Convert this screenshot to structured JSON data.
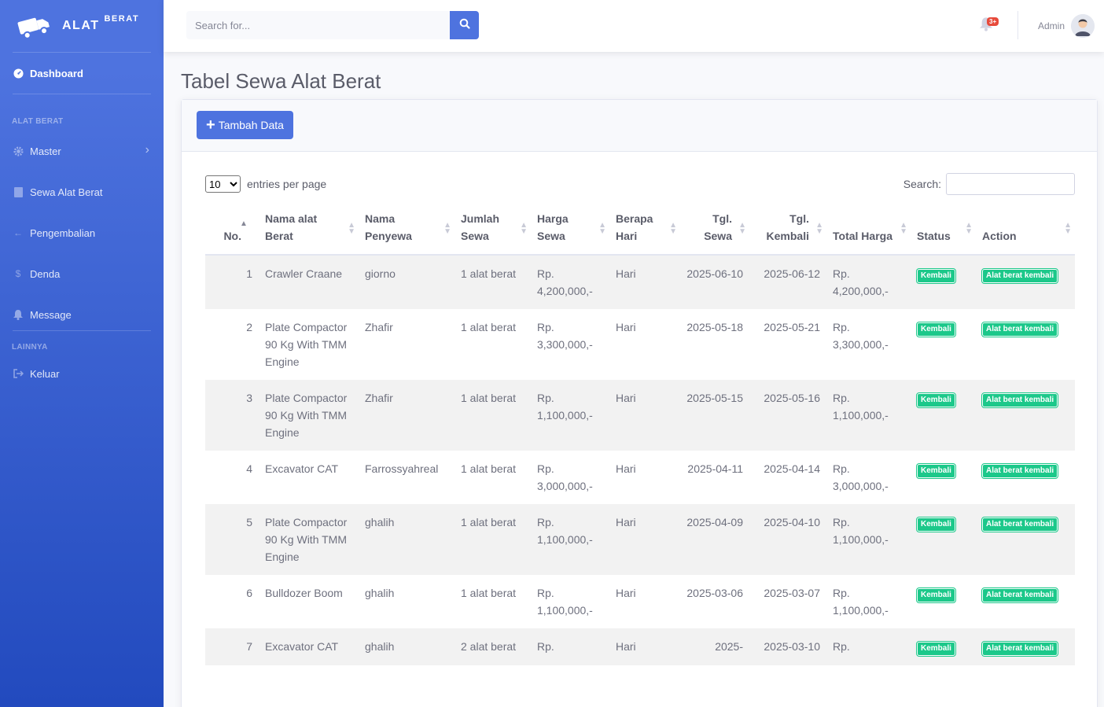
{
  "brand": {
    "name": "ALAT",
    "sup": "BERAT"
  },
  "sidebar": {
    "dashboard": "Dashboard",
    "heading1": "ALAT BERAT",
    "items1": [
      {
        "label": "Master",
        "icon": "gear-icon"
      },
      {
        "label": "Sewa Alat Berat",
        "icon": "book-icon"
      },
      {
        "label": "Pengembalian",
        "icon": "arrow-left-icon"
      },
      {
        "label": "Denda",
        "icon": "dollar-icon"
      },
      {
        "label": "Message",
        "icon": "bell-icon"
      }
    ],
    "heading2": "LAINNYA",
    "logout": "Keluar"
  },
  "topbar": {
    "search_placeholder": "Search for...",
    "notif_count": "3+",
    "user": "Admin"
  },
  "page": {
    "title": "Tabel Sewa Alat Berat",
    "add_button": "Tambah Data",
    "entries_value": "10",
    "entries_label": "entries per page",
    "search_label": "Search:"
  },
  "table": {
    "headers": [
      "No.",
      "Nama alat Berat",
      "Nama Penyewa",
      "Jumlah Sewa",
      "Harga Sewa",
      "Berapa Hari",
      "Tgl. Sewa",
      "Tgl. Kembali",
      "Total Harga",
      "Status",
      "Action"
    ],
    "rows": [
      {
        "no": "1",
        "alat": "Crawler Craane",
        "penyewa": "giorno",
        "jumlah": "1 alat berat",
        "harga": "Rp. 4,200,000,-",
        "hari": "Hari",
        "tgl_sewa": "2025-06-10",
        "tgl_kembali": "2025-06-12",
        "total": "Rp. 4,200,000,-",
        "status": "Kembali",
        "action": "Alat berat kembali"
      },
      {
        "no": "2",
        "alat": "Plate Compactor 90 Kg With TMM Engine",
        "penyewa": "Zhafir",
        "jumlah": "1 alat berat",
        "harga": "Rp. 3,300,000,-",
        "hari": "Hari",
        "tgl_sewa": "2025-05-18",
        "tgl_kembali": "2025-05-21",
        "total": "Rp. 3,300,000,-",
        "status": "Kembali",
        "action": "Alat berat kembali"
      },
      {
        "no": "3",
        "alat": "Plate Compactor 90 Kg With TMM Engine",
        "penyewa": "Zhafir",
        "jumlah": "1 alat berat",
        "harga": "Rp. 1,100,000,-",
        "hari": "Hari",
        "tgl_sewa": "2025-05-15",
        "tgl_kembali": "2025-05-16",
        "total": "Rp. 1,100,000,-",
        "status": "Kembali",
        "action": "Alat berat kembali"
      },
      {
        "no": "4",
        "alat": "Excavator CAT",
        "penyewa": "Farrossyahreal",
        "jumlah": "1 alat berat",
        "harga": "Rp. 3,000,000,-",
        "hari": "Hari",
        "tgl_sewa": "2025-04-11",
        "tgl_kembali": "2025-04-14",
        "total": "Rp. 3,000,000,-",
        "status": "Kembali",
        "action": "Alat berat kembali"
      },
      {
        "no": "5",
        "alat": "Plate Compactor 90 Kg With TMM Engine",
        "penyewa": "ghalih",
        "jumlah": "1 alat berat",
        "harga": "Rp. 1,100,000,-",
        "hari": "Hari",
        "tgl_sewa": "2025-04-09",
        "tgl_kembali": "2025-04-10",
        "total": "Rp. 1,100,000,-",
        "status": "Kembali",
        "action": "Alat berat kembali"
      },
      {
        "no": "6",
        "alat": "Bulldozer Boom",
        "penyewa": "ghalih",
        "jumlah": "1 alat berat",
        "harga": "Rp. 1,100,000,-",
        "hari": "Hari",
        "tgl_sewa": "2025-03-06",
        "tgl_kembali": "2025-03-07",
        "total": "Rp. 1,100,000,-",
        "status": "Kembali",
        "action": "Alat berat kembali"
      },
      {
        "no": "7",
        "alat": "Excavator CAT",
        "penyewa": "ghalih",
        "jumlah": "2 alat berat",
        "harga": "Rp.",
        "hari": "Hari",
        "tgl_sewa": "2025-",
        "tgl_kembali": "2025-03-10",
        "total": "Rp.",
        "status": "Kembali",
        "action": "Alat berat kembali"
      }
    ]
  }
}
